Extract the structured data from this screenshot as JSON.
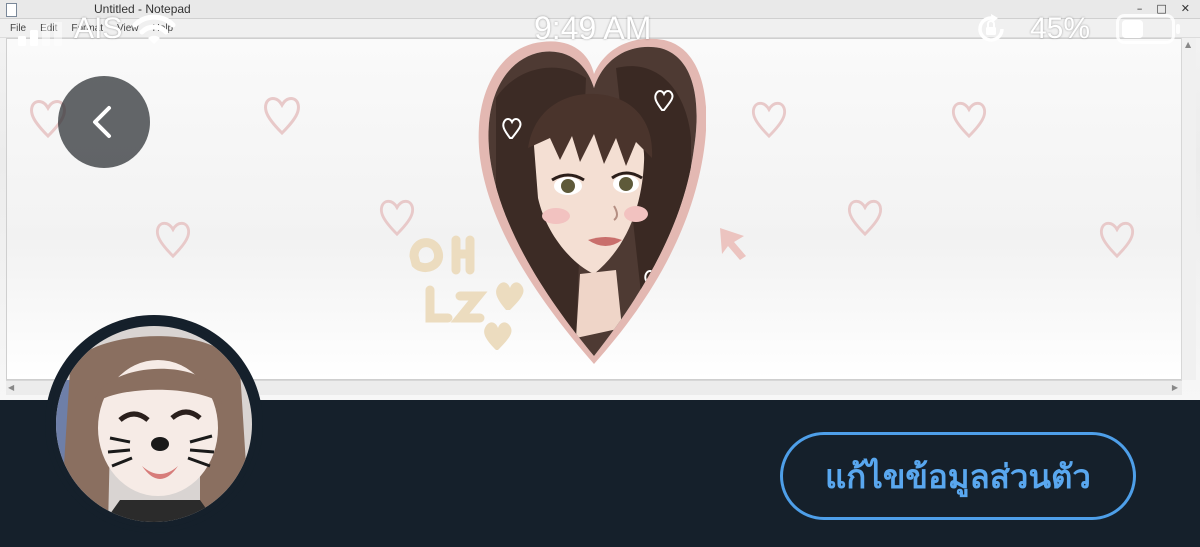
{
  "status_bar": {
    "carrier": "AIS",
    "time": "9:49 AM",
    "battery_percent": "45%",
    "battery_level": 0.45,
    "icons": [
      "signal-bars-icon",
      "wifi-icon",
      "rotation-lock-icon",
      "battery-icon"
    ]
  },
  "banner": {
    "window_title": "Untitled - Notepad",
    "menu_items": [
      "File",
      "Edit",
      "Format",
      "View",
      "Help"
    ],
    "window_controls": [
      "–",
      "□",
      "✕"
    ]
  },
  "profile": {
    "edit_button_label": "แก้ไขข้อมูลส่วนตัว"
  },
  "colors": {
    "background": "#15202b",
    "accent": "#4e9fe9",
    "heart_outline": "#e7c6c6"
  }
}
